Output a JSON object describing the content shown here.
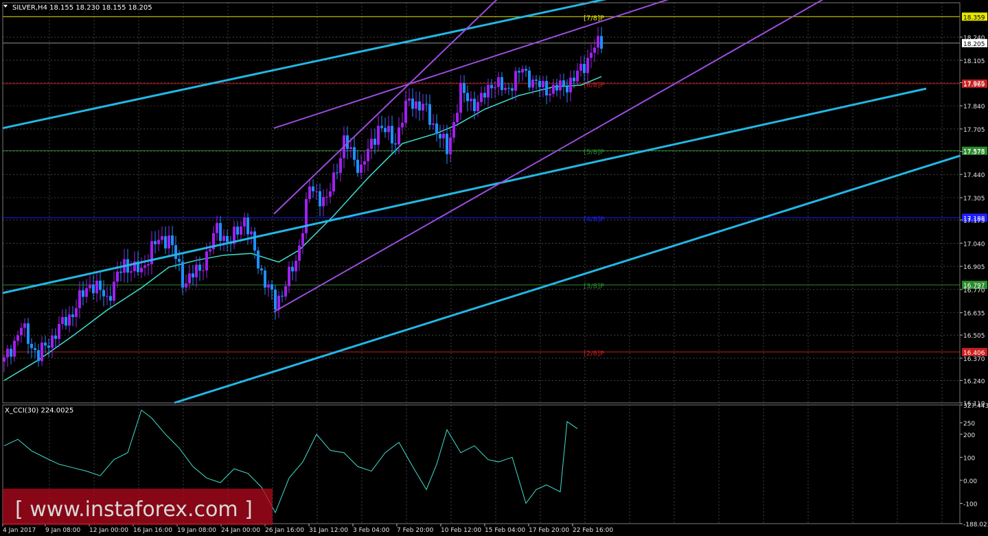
{
  "header": {
    "title": "SILVER,H4  18.155 18.230 18.155 18.205"
  },
  "indicator": {
    "label": "X_CCI(30) 224.0025"
  },
  "watermark": {
    "text": "[ www.instaforex.com ]"
  },
  "colors": {
    "background": "#000000",
    "grid": "#6e6e6e",
    "bull": "#a020f0",
    "bear": "#1e90ff",
    "ma": "#40e0d0",
    "trendline": "#23b7e5",
    "channel": "#9b4dde",
    "level_red": "#c81e1e",
    "level_blue": "#1e1eff",
    "level_green": "#2a8c2a",
    "level_yellow": "#e6e600"
  },
  "chart_data": [
    {
      "type": "candlestick",
      "title": "SILVER,H4",
      "ylim": [
        16.11,
        18.44
      ],
      "y_ticks": [
        "18.240",
        "18.105",
        "17.975",
        "17.840",
        "17.705",
        "17.575",
        "17.440",
        "17.305",
        "17.175",
        "17.040",
        "16.905",
        "16.770",
        "16.635",
        "16.505",
        "16.370",
        "16.240",
        "16.110"
      ],
      "x_ticks": [
        "4 Jan 2017",
        "9 Jan 08:00",
        "12 Jan 00:00",
        "16 Jan 16:00",
        "19 Jan 08:00",
        "24 Jan 00:00",
        "26 Jan 16:00",
        "31 Jan 12:00",
        "3 Feb 04:00",
        "7 Feb 20:00",
        "10 Feb 12:00",
        "15 Feb 04:00",
        "17 Feb 20:00",
        "22 Feb 16:00"
      ],
      "current_price": "18.205",
      "levels": [
        {
          "label": "[7/8]P",
          "value": "18.359",
          "color": "#e6e600"
        },
        {
          "label": "[6/8]P",
          "value": "17.969",
          "color": "#c81e1e"
        },
        {
          "label": "[5/8]P",
          "value": "17.578",
          "color": "#2a8c2a"
        },
        {
          "label": "[4/8]P",
          "value": "17.188",
          "color": "#1e1eff"
        },
        {
          "label": "[3/8]P",
          "value": "16.797",
          "color": "#2a8c2a"
        },
        {
          "label": "[2/8]P",
          "value": "16.406",
          "color": "#c81e1e"
        }
      ],
      "price_path": [
        [
          0,
          16.35
        ],
        [
          5,
          16.55
        ],
        [
          10,
          16.38
        ],
        [
          15,
          16.52
        ],
        [
          20,
          16.64
        ],
        [
          25,
          16.81
        ],
        [
          30,
          16.72
        ],
        [
          35,
          16.92
        ],
        [
          40,
          16.87
        ],
        [
          43,
          17.02
        ],
        [
          48,
          17.08
        ],
        [
          52,
          16.82
        ],
        [
          57,
          16.88
        ],
        [
          62,
          17.12
        ],
        [
          66,
          17.04
        ],
        [
          70,
          17.19
        ],
        [
          74,
          16.92
        ],
        [
          79,
          16.68
        ],
        [
          85,
          16.93
        ],
        [
          89,
          17.36
        ],
        [
          94,
          17.28
        ],
        [
          99,
          17.63
        ],
        [
          104,
          17.47
        ],
        [
          109,
          17.72
        ],
        [
          114,
          17.64
        ],
        [
          118,
          17.88
        ],
        [
          123,
          17.81
        ],
        [
          129,
          17.58
        ],
        [
          133,
          17.92
        ],
        [
          138,
          17.84
        ],
        [
          142,
          17.98
        ],
        [
          146,
          17.93
        ],
        [
          151,
          18.05
        ],
        [
          155,
          17.96
        ],
        [
          160,
          17.93
        ],
        [
          166,
          17.99
        ],
        [
          172,
          18.18
        ],
        [
          174,
          18.205
        ]
      ],
      "ma_path": [
        [
          0,
          16.24
        ],
        [
          10,
          16.36
        ],
        [
          20,
          16.5
        ],
        [
          30,
          16.65
        ],
        [
          40,
          16.78
        ],
        [
          48,
          16.9
        ],
        [
          56,
          16.94
        ],
        [
          64,
          16.97
        ],
        [
          72,
          16.98
        ],
        [
          80,
          16.93
        ],
        [
          86,
          17.0
        ],
        [
          96,
          17.2
        ],
        [
          106,
          17.42
        ],
        [
          116,
          17.62
        ],
        [
          126,
          17.68
        ],
        [
          132,
          17.73
        ],
        [
          140,
          17.82
        ],
        [
          150,
          17.9
        ],
        [
          160,
          17.95
        ],
        [
          168,
          17.96
        ],
        [
          174,
          18.01
        ]
      ],
      "trendlines": [
        {
          "name": "upper-trendline",
          "from": [
            0,
            17.71
          ],
          "to": [
            269,
            18.86
          ]
        },
        {
          "name": "middle-trendline",
          "from": [
            0,
            16.75
          ],
          "to": [
            269,
            17.94
          ]
        },
        {
          "name": "lower-trendline",
          "from": [
            50,
            16.11
          ],
          "to": [
            279,
            17.55
          ]
        }
      ],
      "channel_lines": [
        {
          "name": "channel-upper",
          "from": [
            79,
            17.71
          ],
          "to": [
            194,
            18.46
          ]
        },
        {
          "name": "channel-lower",
          "from": [
            79,
            16.64
          ],
          "to": [
            239,
            18.46
          ]
        },
        {
          "name": "channel-mid",
          "from": [
            79,
            17.21
          ],
          "to": [
            144,
            18.46
          ]
        }
      ]
    },
    {
      "type": "line",
      "title": "X_CCI(30) 224.0025",
      "ylim": [
        -188.023,
        327.4432
      ],
      "y_ticks": [
        "327.4432",
        "250",
        "200",
        "100",
        "0.00",
        "-100",
        "-188.023"
      ],
      "values": [
        [
          0,
          150
        ],
        [
          4,
          178
        ],
        [
          8,
          128
        ],
        [
          12,
          98
        ],
        [
          16,
          70
        ],
        [
          20,
          55
        ],
        [
          24,
          40
        ],
        [
          28,
          20
        ],
        [
          32,
          90
        ],
        [
          36,
          120
        ],
        [
          40,
          305
        ],
        [
          43,
          270
        ],
        [
          47,
          200
        ],
        [
          51,
          140
        ],
        [
          55,
          60
        ],
        [
          59,
          10
        ],
        [
          63,
          -10
        ],
        [
          67,
          50
        ],
        [
          71,
          30
        ],
        [
          75,
          -30
        ],
        [
          79,
          -140
        ],
        [
          83,
          10
        ],
        [
          87,
          80
        ],
        [
          91,
          200
        ],
        [
          95,
          130
        ],
        [
          99,
          120
        ],
        [
          103,
          60
        ],
        [
          107,
          40
        ],
        [
          111,
          120
        ],
        [
          115,
          165
        ],
        [
          119,
          60
        ],
        [
          123,
          -40
        ],
        [
          126,
          70
        ],
        [
          129,
          220
        ],
        [
          133,
          120
        ],
        [
          137,
          150
        ],
        [
          141,
          90
        ],
        [
          144,
          80
        ],
        [
          148,
          100
        ],
        [
          152,
          -100
        ],
        [
          155,
          -40
        ],
        [
          158,
          -20
        ],
        [
          162,
          -50
        ],
        [
          164,
          255
        ],
        [
          167,
          224
        ]
      ]
    }
  ]
}
